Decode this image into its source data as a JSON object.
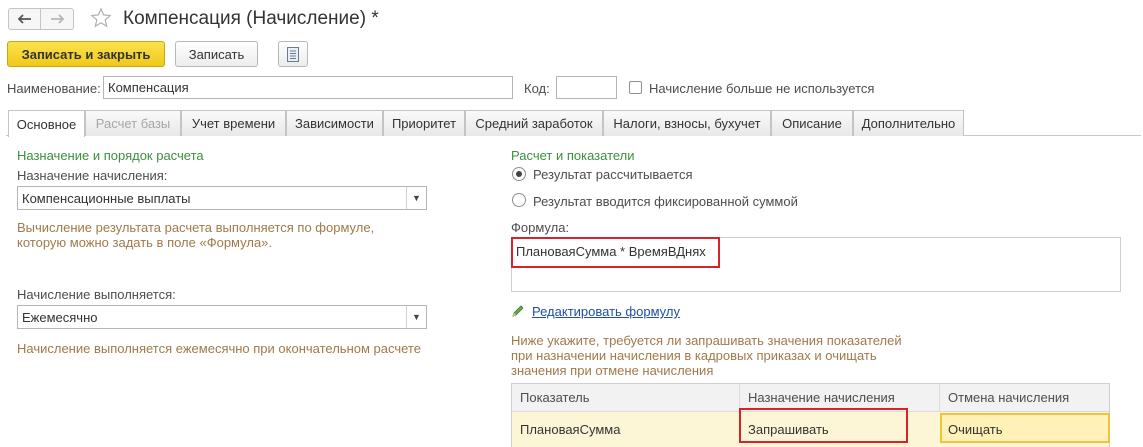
{
  "window": {
    "title": "Компенсация (Начисление) *"
  },
  "toolbar": {
    "save_close_label": "Записать и закрыть",
    "save_label": "Записать"
  },
  "header": {
    "name_label": "Наименование:",
    "name_value": "Компенсация",
    "code_label": "Код:",
    "code_value": "",
    "not_used_label": "Начисление больше не используется"
  },
  "tabs": [
    {
      "label": "Основное"
    },
    {
      "label": "Расчет базы"
    },
    {
      "label": "Учет времени"
    },
    {
      "label": "Зависимости"
    },
    {
      "label": "Приоритет"
    },
    {
      "label": "Средний заработок"
    },
    {
      "label": "Налоги, взносы, бухучет"
    },
    {
      "label": "Описание"
    },
    {
      "label": "Дополнительно"
    }
  ],
  "left": {
    "section_title": "Назначение и порядок расчета",
    "purpose_label": "Назначение начисления:",
    "purpose_value": "Компенсационные выплаты",
    "purpose_hint_line1": "Вычисление результата расчета выполняется по формуле,",
    "purpose_hint_line2": "которую можно задать в поле «Формула».",
    "performed_label": "Начисление выполняется:",
    "performed_value": "Ежемесячно",
    "performed_hint": "Начисление выполняется ежемесячно при окончательном расчете"
  },
  "right": {
    "section_title": "Расчет и показатели",
    "radio_calculated": "Результат рассчитывается",
    "radio_fixed": "Результат вводится фиксированной суммой",
    "formula_label": "Формула:",
    "formula_value": "ПлановаяСумма * ВремяВДнях",
    "edit_formula_link": "Редактировать формулу",
    "indicators_hint_line1": "Ниже укажите, требуется ли запрашивать значения показателей",
    "indicators_hint_line2": "при назначении начисления в кадровых приказах и очищать",
    "indicators_hint_line3": "значения при отмене начисления",
    "table": {
      "headers": [
        "Показатель",
        "Назначение начисления",
        "Отмена начисления"
      ],
      "rows": [
        [
          "ПлановаяСумма",
          "Запрашивать",
          "Очищать"
        ]
      ]
    }
  },
  "colors": {
    "primary_button": "#f5d23a",
    "section_title": "#3c8f3c",
    "hint_text": "#a07a4a",
    "link": "#1f4fa3",
    "highlight_box": "#d8232a",
    "selected_row": "#fdf6d6"
  }
}
